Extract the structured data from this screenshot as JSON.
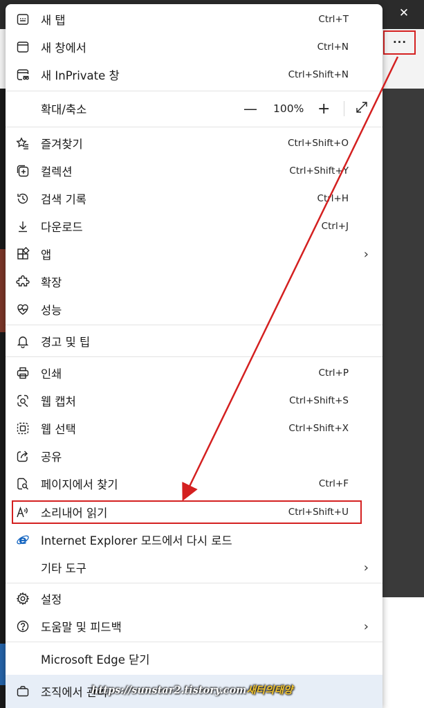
{
  "window": {
    "close_glyph": "✕",
    "more_glyph": "···"
  },
  "menu": {
    "items": [
      {
        "label": "새 탭",
        "shortcut": "Ctrl+T",
        "icon": "new-tab-icon"
      },
      {
        "label": "새 창에서",
        "shortcut": "Ctrl+N",
        "icon": "new-window-icon"
      },
      {
        "label": "새 InPrivate 창",
        "shortcut": "Ctrl+Shift+N",
        "icon": "inprivate-icon"
      },
      {
        "label": "확대/축소",
        "zoom_value": "100%",
        "minus": "—",
        "plus": "+",
        "icon": "fullscreen-icon"
      },
      {
        "label": "즐겨찾기",
        "shortcut": "Ctrl+Shift+O",
        "icon": "favorites-icon"
      },
      {
        "label": "컬렉션",
        "shortcut": "Ctrl+Shift+Y",
        "icon": "collections-icon"
      },
      {
        "label": "검색 기록",
        "shortcut": "Ctrl+H",
        "icon": "history-icon"
      },
      {
        "label": "다운로드",
        "shortcut": "Ctrl+J",
        "icon": "download-icon"
      },
      {
        "label": "앱",
        "icon": "apps-icon"
      },
      {
        "label": "확장",
        "icon": "extensions-icon"
      },
      {
        "label": "성능",
        "icon": "performance-icon"
      },
      {
        "label": "경고 및 팁",
        "icon": "bell-icon"
      },
      {
        "label": "인쇄",
        "shortcut": "Ctrl+P",
        "icon": "print-icon"
      },
      {
        "label": "웹 캡처",
        "shortcut": "Ctrl+Shift+S",
        "icon": "web-capture-icon"
      },
      {
        "label": "웹 선택",
        "shortcut": "Ctrl+Shift+X",
        "icon": "web-select-icon"
      },
      {
        "label": "공유",
        "icon": "share-icon"
      },
      {
        "label": "페이지에서 찾기",
        "shortcut": "Ctrl+F",
        "icon": "find-icon"
      },
      {
        "label": "소리내어 읽기",
        "shortcut": "Ctrl+Shift+U",
        "icon": "read-aloud-icon"
      },
      {
        "label": "Internet Explorer 모드에서 다시 로드",
        "icon": "ie-icon"
      },
      {
        "label": "기타 도구"
      },
      {
        "label": "설정",
        "icon": "gear-icon"
      },
      {
        "label": "도움말 및 피드백",
        "icon": "help-icon"
      },
      {
        "label": "Microsoft Edge 닫기"
      },
      {
        "label": "조직에서 관리",
        "icon": "briefcase-icon"
      }
    ]
  },
  "watermark": {
    "url": "https://sunstar2.tistory.com",
    "name": "새터의태양"
  },
  "colors": {
    "highlight": "#d42020",
    "menu_bg": "#ffffff",
    "bottom_row_bg": "#e7eef7"
  }
}
